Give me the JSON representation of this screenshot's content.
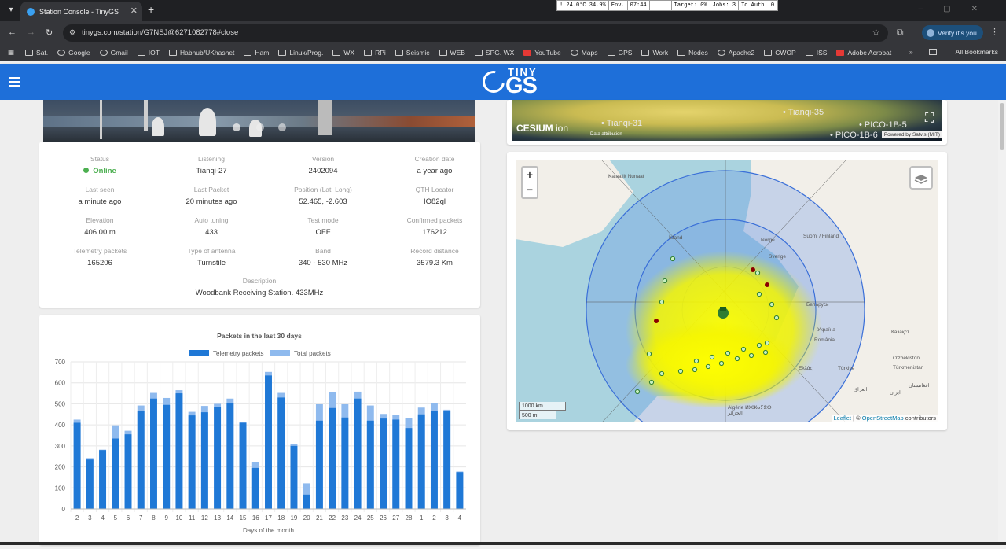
{
  "browser": {
    "tab_title": "Station Console - TinyGS",
    "url": "tinygs.com/station/G7NSJ@6271082778#close",
    "verify_label": "Verify it's you",
    "sysmon": [
      "! 24.0°C  34.9%",
      "Env.",
      "07:44",
      "",
      "Target: 0%",
      "Jobs: 3",
      "To Auth: 0"
    ],
    "bookmarks": [
      {
        "label": "Sat.",
        "icon": "folder"
      },
      {
        "label": "Google",
        "icon": "globe"
      },
      {
        "label": "Gmail",
        "icon": "gmail"
      },
      {
        "label": "IOT",
        "icon": "folder"
      },
      {
        "label": "Habhub/UKhasnet",
        "icon": "folder"
      },
      {
        "label": "Ham",
        "icon": "folder"
      },
      {
        "label": "Linux/Prog.",
        "icon": "folder"
      },
      {
        "label": "WX",
        "icon": "folder"
      },
      {
        "label": "RPi",
        "icon": "folder"
      },
      {
        "label": "Seismic",
        "icon": "folder"
      },
      {
        "label": "WEB",
        "icon": "folder"
      },
      {
        "label": "SPG. WX",
        "icon": "page"
      },
      {
        "label": "YouTube",
        "icon": "youtube"
      },
      {
        "label": "Maps",
        "icon": "maps"
      },
      {
        "label": "GPS",
        "icon": "folder"
      },
      {
        "label": "Work",
        "icon": "folder"
      },
      {
        "label": "Nodes",
        "icon": "folder"
      },
      {
        "label": "Apache2",
        "icon": "globe"
      },
      {
        "label": "CWOP",
        "icon": "folder"
      },
      {
        "label": "ISS",
        "icon": "folder"
      },
      {
        "label": "Adobe Acrobat",
        "icon": "acrobat"
      }
    ],
    "bookmarks_more": "»",
    "all_bookmarks": "All Bookmarks"
  },
  "app": {
    "logo_top": "TINY",
    "logo_main": "GS"
  },
  "station": {
    "fields": [
      {
        "label": "Status",
        "value": "Online"
      },
      {
        "label": "Listening",
        "value": "Tianqi-27"
      },
      {
        "label": "Version",
        "value": "2402094"
      },
      {
        "label": "Creation date",
        "value": "a year ago"
      },
      {
        "label": "Last seen",
        "value": "a minute ago"
      },
      {
        "label": "Last Packet",
        "value": "20 minutes ago"
      },
      {
        "label": "Position (Lat, Long)",
        "value": "52.465, -2.603"
      },
      {
        "label": "QTH Locator",
        "value": "IO82ql"
      },
      {
        "label": "Elevation",
        "value": "406.00 m"
      },
      {
        "label": "Auto tuning",
        "value": "433"
      },
      {
        "label": "Test mode",
        "value": "OFF"
      },
      {
        "label": "Confirmed packets",
        "value": "176212"
      },
      {
        "label": "Telemetry packets",
        "value": "165206"
      },
      {
        "label": "Type of antenna",
        "value": "Turnstile"
      },
      {
        "label": "Band",
        "value": "340 - 530 MHz"
      },
      {
        "label": "Record distance",
        "value": "3579.3 Km"
      }
    ],
    "description_label": "Description",
    "description": "Woodbank Receiving Station. 433MHz"
  },
  "cesium": {
    "brand": "CESIUM",
    "brand_suffix": "ion",
    "data_attribution": "Data attribution",
    "satellites": [
      "Tianqi-31",
      "Tianqi-35",
      "PICO-1B-5",
      "PICO-1B-6"
    ],
    "powered_by": "Powered by Satvis (MIT)"
  },
  "map": {
    "zoom_in": "+",
    "zoom_out": "−",
    "scale_km": "1000 km",
    "scale_mi": "500 mi",
    "attribution_leaflet": "Leaflet",
    "attribution_sep": " | © ",
    "attribution_osm": "OpenStreetMap",
    "attribution_tail": " contributors",
    "labels": [
      "Kalaallit Nunaat",
      "Ísland",
      "Norge",
      "Suomi / Finland",
      "Sverige",
      "Беларусь",
      "Україна",
      "România",
      "Қазақст",
      "Türkiye",
      "Ελλάς",
      "Oʻzbekiston",
      "Türkmenistan",
      "العراق",
      "ایران",
      "افغانستان",
      "Algérie ⵍⵣⵣⴰⵢⴻⵔ",
      "الجزائر"
    ]
  },
  "chart_data": {
    "type": "bar",
    "title": "Packets in the last 30 days",
    "xlabel": "Days of the month",
    "ylabel": "",
    "ylim": [
      0,
      700
    ],
    "yticks": [
      0,
      100,
      200,
      300,
      400,
      500,
      600,
      700
    ],
    "legend_position": "top",
    "categories": [
      "2",
      "3",
      "4",
      "5",
      "6",
      "7",
      "8",
      "9",
      "10",
      "11",
      "12",
      "13",
      "14",
      "15",
      "16",
      "17",
      "18",
      "19",
      "20",
      "21",
      "22",
      "23",
      "24",
      "25",
      "26",
      "27",
      "28",
      "1",
      "2",
      "3",
      "4"
    ],
    "series": [
      {
        "name": "Telemetry packets",
        "color": "#1f78d6",
        "values": [
          410,
          235,
          280,
          335,
          355,
          465,
          525,
          495,
          550,
          445,
          460,
          485,
          505,
          410,
          195,
          635,
          530,
          300,
          68,
          420,
          480,
          435,
          525,
          420,
          430,
          425,
          385,
          450,
          465,
          465,
          175
        ]
      },
      {
        "name": "Total packets",
        "color": "#8fbaee",
        "values": [
          425,
          242,
          282,
          398,
          372,
          492,
          552,
          528,
          565,
          462,
          490,
          500,
          525,
          415,
          222,
          652,
          552,
          308,
          122,
          498,
          555,
          498,
          558,
          492,
          452,
          448,
          432,
          482,
          505,
          472,
          178
        ]
      }
    ]
  }
}
